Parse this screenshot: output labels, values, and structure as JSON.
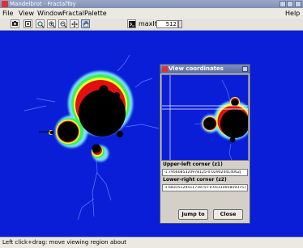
{
  "window": {
    "title": "Mandelbrot - FractalToy"
  },
  "menubar": {
    "items": [
      "File",
      "View",
      "Window",
      "Fractal",
      "Palette"
    ],
    "help": "Help"
  },
  "toolbar": {
    "maxiter_label": "maxIter",
    "maxiter_value": "512",
    "buttons": [
      "render-icon",
      "image-icon",
      "zoom-fit-icon",
      "zoom-in-icon",
      "zoom-out-icon",
      "pan-icon",
      "hand-icon",
      "terminal-icon"
    ]
  },
  "dialog": {
    "title": "View coordinates",
    "upper_left_label": "Upper-left corner (z1)",
    "upper_left_value": "-1.7956085320978125-0.029024414062J",
    "lower_right_label": "Lower-right corner (z2)",
    "lower_right_value": "-1.6831512451171875+0.05310058593757",
    "jump_label": "Jump to",
    "close_label": "Close"
  },
  "status": {
    "text": "Left click+drag: move viewing region about"
  },
  "colors": {
    "fractal_bg": "#0a1ed8",
    "set_fill": "#000000",
    "ring_yellow": "#f6ff2e",
    "ring_red": "#e01010",
    "ring_green": "#3df05a",
    "ring_cyan": "#7ee8ff"
  }
}
